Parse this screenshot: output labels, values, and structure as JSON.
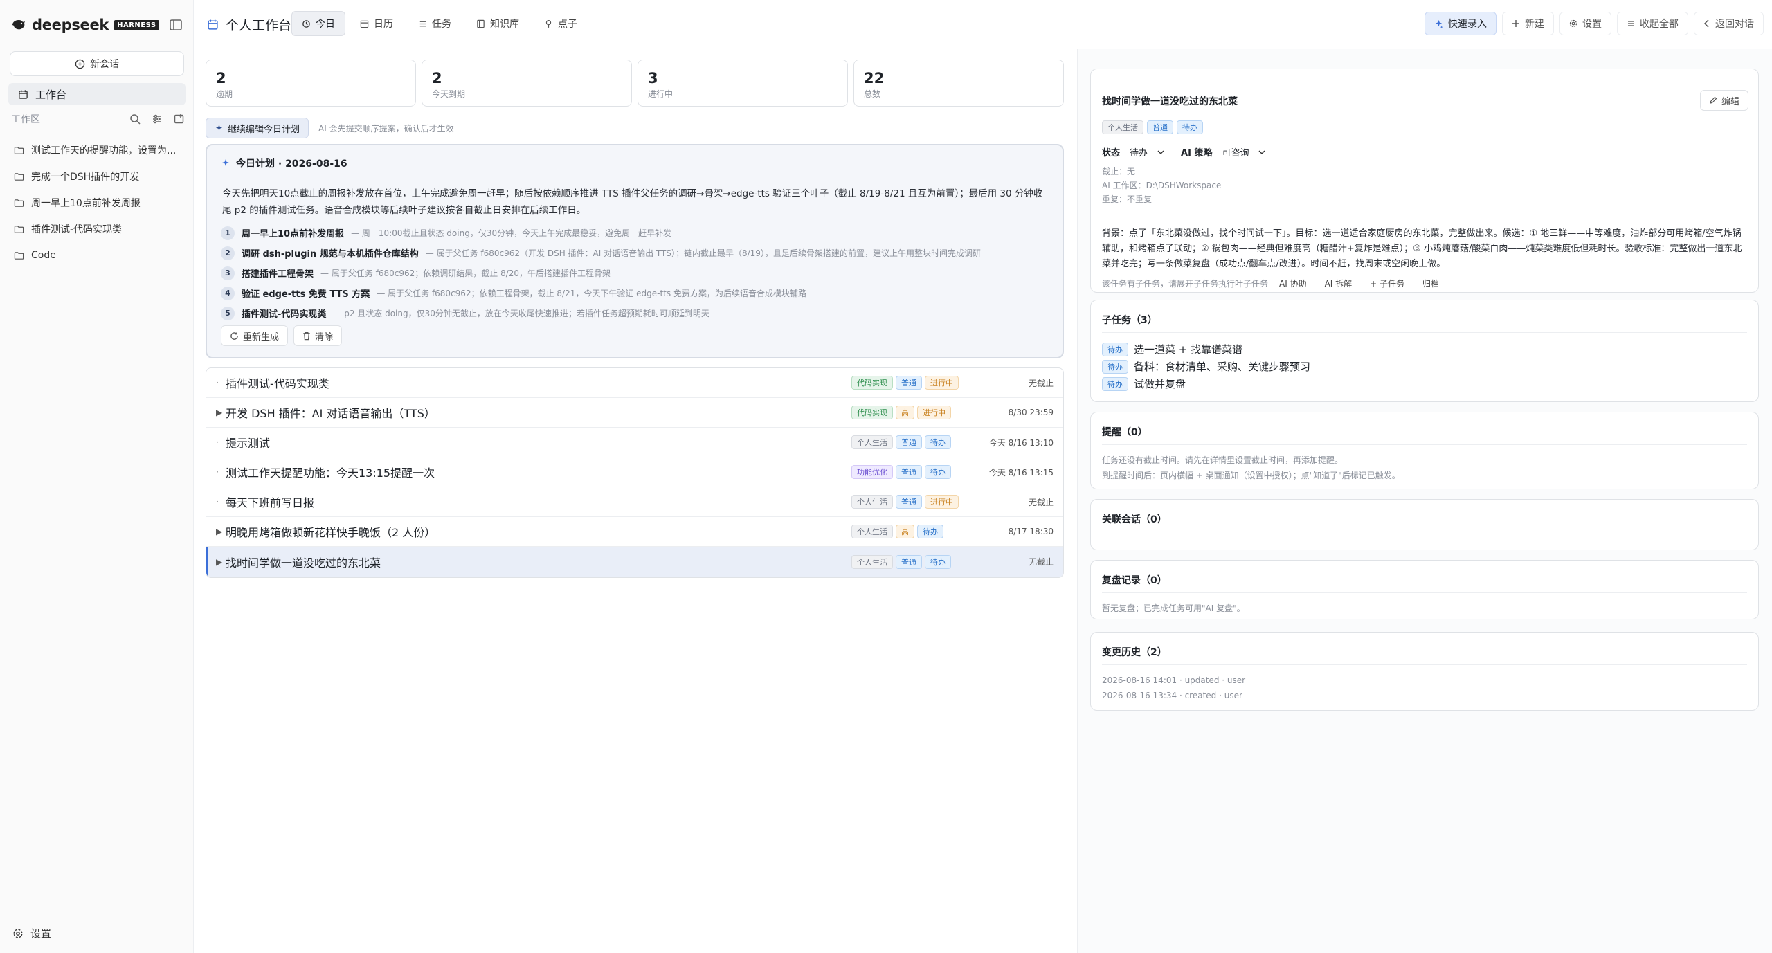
{
  "sidebar": {
    "brand_name": "deepseek",
    "brand_badge": "HARNESS",
    "new_chat": "新会话",
    "workbench": "工作台",
    "workspace_title": "工作区",
    "items": [
      {
        "label": "测试工作天的提醒功能，设置为..."
      },
      {
        "label": "完成一个DSH插件的开发"
      },
      {
        "label": "周一早上10点前补发周报"
      },
      {
        "label": "插件测试-代码实现类"
      },
      {
        "label": "Code"
      }
    ],
    "settings": "设置"
  },
  "topbar": {
    "title": "个人工作台",
    "tabs": [
      {
        "label": "今日",
        "icon": "sun-icon",
        "active": true
      },
      {
        "label": "日历",
        "icon": "calendar-icon"
      },
      {
        "label": "任务",
        "icon": "list-icon"
      },
      {
        "label": "知识库",
        "icon": "book-icon"
      },
      {
        "label": "点子",
        "icon": "pin-icon"
      }
    ],
    "actions": {
      "quick_entry": "快速录入",
      "new": "新建",
      "settings": "设置",
      "collapse_all": "收起全部",
      "back": "返回对话"
    }
  },
  "stats": [
    {
      "value": "2",
      "label": "逾期"
    },
    {
      "value": "2",
      "label": "今天到期"
    },
    {
      "value": "3",
      "label": "进行中"
    },
    {
      "value": "22",
      "label": "总数"
    }
  ],
  "continue": {
    "button": "继续编辑今日计划",
    "hint": "AI 会先提交顺序提案，确认后才生效"
  },
  "plan": {
    "title": "今日计划 · 2026-08-16",
    "summary": "今天先把明天10点截止的周报补发放在首位，上午完成避免周一赶早；随后按依赖顺序推进 TTS 插件父任务的调研→骨架→edge-tts 验证三个叶子（截止 8/19-8/21 且互为前置）；最后用 30 分钟收尾 p2 的插件测试任务。语音合成模块等后续叶子建议按各自截止日安排在后续工作日。",
    "steps": [
      {
        "num": "1",
        "title": "周一早上10点前补发周报",
        "desc": "— 周一10:00截止且状态 doing，仅30分钟，今天上午完成最稳妥，避免周一赶早补发"
      },
      {
        "num": "2",
        "title": "调研 dsh-plugin 规范与本机插件仓库结构",
        "desc": "— 属于父任务 f680c962（开发 DSH 插件：AI 对话语音输出 TTS）；链内截止最早（8/19），且是后续骨架搭建的前置，建议上午用整块时间完成调研"
      },
      {
        "num": "3",
        "title": "搭建插件工程骨架",
        "desc": "— 属于父任务 f680c962；依赖调研结果，截止 8/20，午后搭建插件工程骨架"
      },
      {
        "num": "4",
        "title": "验证 edge-tts 免费 TTS 方案",
        "desc": "— 属于父任务 f680c962；依赖工程骨架，截止 8/21，今天下午验证 edge-tts 免费方案，为后续语音合成模块铺路"
      },
      {
        "num": "5",
        "title": "插件测试-代码实现类",
        "desc": "— p2 且状态 doing，仅30分钟无截止，放在今天收尾快速推进；若插件任务超预期耗时可顺延到明天"
      }
    ],
    "regenerate": "重新生成",
    "clear": "清除"
  },
  "tasks": [
    {
      "caret": "·",
      "title": "插件测试-代码实现类",
      "tags": [
        {
          "text": "代码实现",
          "style": "green"
        },
        {
          "text": "普通",
          "style": "blue"
        },
        {
          "text": "进行中",
          "style": "orange"
        }
      ],
      "due": "无截止"
    },
    {
      "caret": "▶",
      "title": "开发 DSH 插件：AI 对话语音输出（TTS）",
      "tags": [
        {
          "text": "代码实现",
          "style": "green"
        },
        {
          "text": "高",
          "style": "orange"
        },
        {
          "text": "进行中",
          "style": "orange"
        }
      ],
      "due": "8/30 23:59"
    },
    {
      "caret": "·",
      "title": "提示测试",
      "tags": [
        {
          "text": "个人生活",
          "style": "gray"
        },
        {
          "text": "普通",
          "style": "blue"
        },
        {
          "text": "待办",
          "style": "blue"
        }
      ],
      "due": "今天 8/16 13:10"
    },
    {
      "caret": "·",
      "title": "测试工作天提醒功能：今天13:15提醒一次",
      "tags": [
        {
          "text": "功能优化",
          "style": "purple"
        },
        {
          "text": "普通",
          "style": "blue"
        },
        {
          "text": "待办",
          "style": "blue"
        }
      ],
      "due": "今天 8/16 13:15"
    },
    {
      "caret": "·",
      "title": "每天下班前写日报",
      "tags": [
        {
          "text": "个人生活",
          "style": "gray"
        },
        {
          "text": "普通",
          "style": "blue"
        },
        {
          "text": "进行中",
          "style": "orange"
        }
      ],
      "due": "无截止"
    },
    {
      "caret": "▶",
      "title": "明晚用烤箱做顿新花样快手晚饭（2 人份）",
      "tags": [
        {
          "text": "个人生活",
          "style": "gray"
        },
        {
          "text": "高",
          "style": "orange"
        },
        {
          "text": "待办",
          "style": "blue"
        }
      ],
      "due": "8/17 18:30"
    },
    {
      "caret": "▶",
      "title": "找时间学做一道没吃过的东北菜",
      "tags": [
        {
          "text": "个人生活",
          "style": "gray"
        },
        {
          "text": "普通",
          "style": "blue"
        },
        {
          "text": "待办",
          "style": "blue"
        }
      ],
      "due": "无截止",
      "selected": true
    }
  ],
  "detail": {
    "title": "找时间学做一道没吃过的东北菜",
    "edit": "编辑",
    "tags": [
      {
        "text": "个人生活",
        "style": "gray"
      },
      {
        "text": "普通",
        "style": "blue"
      },
      {
        "text": "待办",
        "style": "blue"
      }
    ],
    "status_label": "状态",
    "status_value": "待办",
    "ai_label": "AI 策略",
    "ai_value": "可咨询",
    "meta": [
      "截止：无",
      "AI 工作区：D:\\DSHWorkspace",
      "重复：不重复"
    ],
    "background": "背景：点子「东北菜没做过，找个时间试一下」。目标：选一道适合家庭厨房的东北菜，完整做出来。候选：① 地三鲜——中等难度，油炸部分可用烤箱/空气炸锅辅助，和烤箱点子联动；② 锅包肉——经典但难度高（糖醋汁+复炸是难点）；③ 小鸡炖蘑菇/酸菜白肉——炖菜类难度低但耗时长。验收标准：完整做出一道东北菜并吃完；写一条做菜复盘（成功点/翻车点/改进）。时间不赶，找周末或空闲晚上做。",
    "action_hint": "该任务有子任务，请展开子任务执行叶子任务",
    "ai_assist": "AI 协助",
    "ai_split": "AI 拆解",
    "add_sub": "+ 子任务",
    "archive": "归档"
  },
  "subtasks": {
    "title": "子任务（3）",
    "items": [
      {
        "tag": "待办",
        "label": "选一道菜 + 找靠谱菜谱"
      },
      {
        "tag": "待办",
        "label": "备料：食材清单、采购、关键步骤预习"
      },
      {
        "tag": "待办",
        "label": "试做并复盘"
      }
    ]
  },
  "reminders": {
    "title": "提醒（0）",
    "lines": [
      "任务还没有截止时间。请先在详情里设置截止时间，再添加提醒。",
      "到提醒时间后：页内横幅 + 桌面通知（设置中授权）；点\"知道了\"后标记已触发。"
    ]
  },
  "linked_chats": {
    "title": "关联会话（0）"
  },
  "reviews": {
    "title": "复盘记录（0）",
    "text": "暂无复盘；已完成任务可用\"AI 复盘\"。"
  },
  "history": {
    "title": "变更历史（2）",
    "lines": [
      "2026-08-16 14:01 · updated · user",
      "2026-08-16 13:34 · created · user"
    ]
  },
  "colors": {
    "accent": "#3b6fd8",
    "brand": "#4d6bfe"
  }
}
